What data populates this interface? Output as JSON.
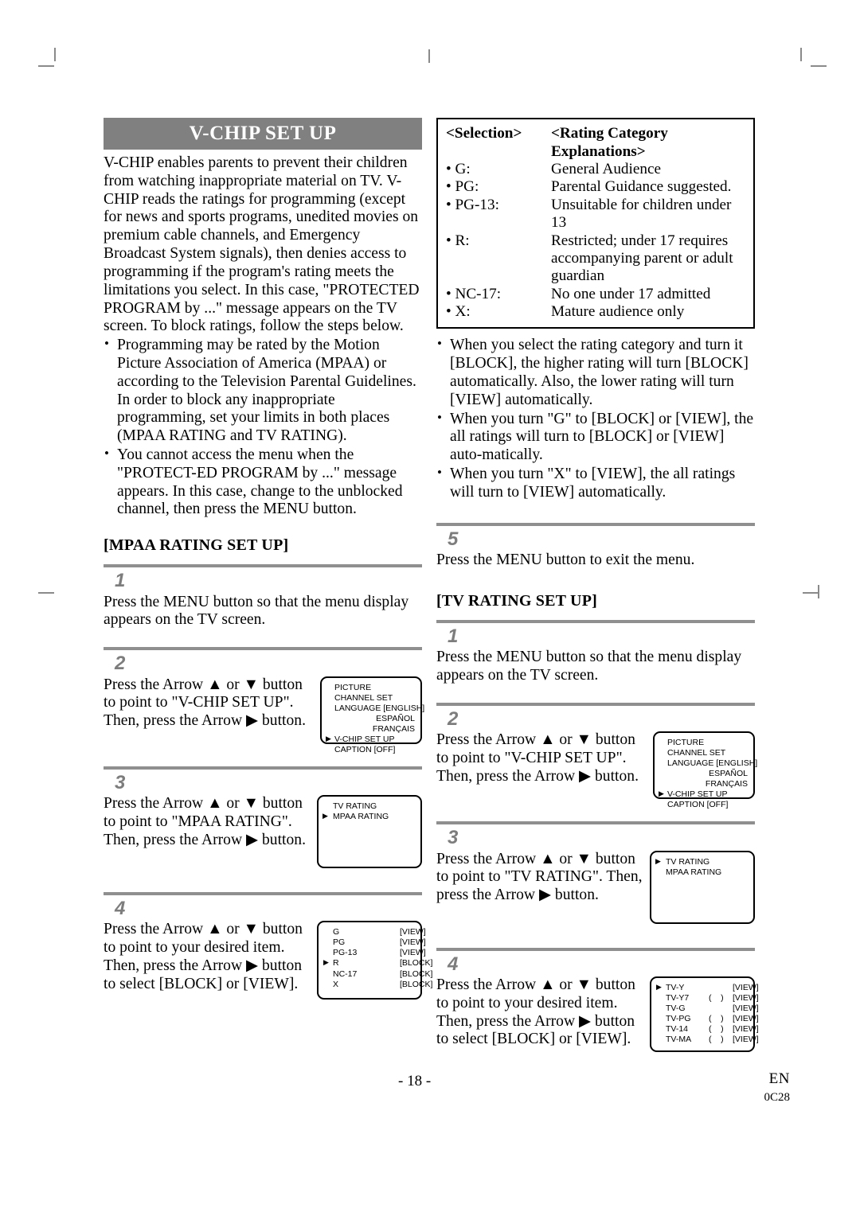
{
  "document": {
    "section_title": "V-CHIP SET UP",
    "footer": {
      "page_number": "- 18 -",
      "language_code": "EN",
      "doc_code": "0C28"
    },
    "colors": {
      "title_bar_background": "#808080",
      "title_bar_text": "#ffffff",
      "rule": "#8f8f8f",
      "step_number": "#7d7d7d"
    }
  },
  "intro": {
    "paragraph": "V-CHIP enables parents to prevent their children from watching inappropriate material on TV. V-CHIP reads the ratings for programming (except for news and sports programs, unedited movies on premium cable channels, and Emergency Broadcast System signals), then denies access to programming if the program's rating meets the limitations you select. In this case, \"PROTECTED PROGRAM by ...\" message appears on the TV screen. To block ratings, follow the steps below.",
    "bullets": [
      "Programming may be rated by the Motion Picture Association of America (MPAA) or according to the Television Parental Guidelines. In order to block any inappropriate programming, set your limits in both places (MPAA RATING and TV RATING).",
      "You cannot access the menu when the \"PROTECT-ED PROGRAM by ...\" message appears. In this case, change to the unblocked channel, then press the MENU button."
    ]
  },
  "rating_table": {
    "header_selection": "<Selection>",
    "header_explanations": "<Rating Category Explanations>",
    "rows": [
      {
        "selection": "• G:",
        "explanation": "General Audience",
        "continuation": []
      },
      {
        "selection": "• PG:",
        "explanation": "Parental Guidance suggested.",
        "continuation": []
      },
      {
        "selection": "• PG-13:",
        "explanation": "Unsuitable for children under 13",
        "continuation": []
      },
      {
        "selection": "• R:",
        "explanation": "Restricted; under 17 requires",
        "continuation": [
          "accompanying parent or adult",
          "guardian"
        ]
      },
      {
        "selection": "• NC-17:",
        "explanation": "No one under 17 admitted",
        "continuation": []
      },
      {
        "selection": "• X:",
        "explanation": "Mature audience only",
        "continuation": []
      }
    ]
  },
  "notes": {
    "bullets": [
      "When you select the rating category and turn it [BLOCK], the higher rating will turn [BLOCK] automatically. Also, the lower rating will turn [VIEW] automatically.",
      "When you turn \"G\" to [BLOCK] or [VIEW], the all ratings will turn to [BLOCK] or [VIEW] auto-matically.",
      "When you turn \"X\" to [VIEW], the all ratings will turn to [VIEW] automatically."
    ]
  },
  "step5": {
    "number": "5",
    "text": "Press the MENU button to exit the menu."
  },
  "mpaa_section": {
    "heading": "[MPAA RATING SET UP]",
    "steps": [
      {
        "number": "1",
        "text": "Press the MENU button so that the menu display appears on the TV screen."
      },
      {
        "number": "2",
        "text": "Press the Arrow ▲ or ▼ button to point to \"V-CHIP SET UP\". Then, press the Arrow ▶ button."
      },
      {
        "number": "3",
        "text": "Press the Arrow ▲ or ▼ button to point to \"MPAA RATING\". Then, press the Arrow ▶ button."
      },
      {
        "number": "4",
        "text": "Press the Arrow ▲ or ▼ button to point to your desired item. Then, press the Arrow ▶ button to select [BLOCK] or [VIEW]."
      }
    ]
  },
  "tv_section": {
    "heading": "[TV RATING SET UP]",
    "steps": [
      {
        "number": "1",
        "text": "Press the MENU button so that the menu display appears on the TV screen."
      },
      {
        "number": "2",
        "text": "Press the Arrow ▲ or ▼ button to point to \"V-CHIP SET UP\". Then, press the Arrow ▶ button."
      },
      {
        "number": "3",
        "text": "Press the Arrow ▲ or ▼ button to point to \"TV RATING\". Then, press the Arrow ▶ button."
      },
      {
        "number": "4",
        "text": "Press the Arrow ▲ or ▼ button to point to your desired item. Then, press the Arrow ▶ button to select [BLOCK] or [VIEW]."
      }
    ]
  },
  "osd": {
    "main_menu": {
      "lines": [
        "PICTURE",
        "CHANNEL SET",
        "LANGUAGE [ENGLISH]"
      ],
      "lang_options": [
        "ESPAÑOL",
        "FRANÇAIS"
      ],
      "selected_line": "V-CHIP SET UP",
      "last_line": "CAPTION [OFF]"
    },
    "vchip_menu_mpaa": {
      "line1": "TV RATING",
      "line2": "MPAA RATING",
      "selected_index": 1
    },
    "vchip_menu_tv": {
      "line1": "TV RATING",
      "line2": "MPAA RATING",
      "selected_index": 0
    },
    "mpaa_rating_menu": {
      "rows": [
        {
          "label": "G",
          "paren": "",
          "value": "[VIEW]",
          "selected": false
        },
        {
          "label": "PG",
          "paren": "",
          "value": "[VIEW]",
          "selected": false
        },
        {
          "label": "PG-13",
          "paren": "",
          "value": "[VIEW]",
          "selected": false
        },
        {
          "label": "R",
          "paren": "",
          "value": "[BLOCK]",
          "selected": true
        },
        {
          "label": "NC-17",
          "paren": "",
          "value": "[BLOCK]",
          "selected": false
        },
        {
          "label": "X",
          "paren": "",
          "value": "[BLOCK]",
          "selected": false
        }
      ]
    },
    "tv_rating_menu": {
      "rows": [
        {
          "label": "TV-Y",
          "paren": "",
          "value": "[VIEW]",
          "selected": true
        },
        {
          "label": "TV-Y7",
          "paren": "(    )",
          "value": "[VIEW]",
          "selected": false
        },
        {
          "label": "TV-G",
          "paren": "",
          "value": "[VIEW]",
          "selected": false
        },
        {
          "label": "TV-PG",
          "paren": "(    )",
          "value": "[VIEW]",
          "selected": false
        },
        {
          "label": "TV-14",
          "paren": "(    )",
          "value": "[VIEW]",
          "selected": false
        },
        {
          "label": "TV-MA",
          "paren": "(    )",
          "value": "[VIEW]",
          "selected": false
        }
      ]
    }
  }
}
